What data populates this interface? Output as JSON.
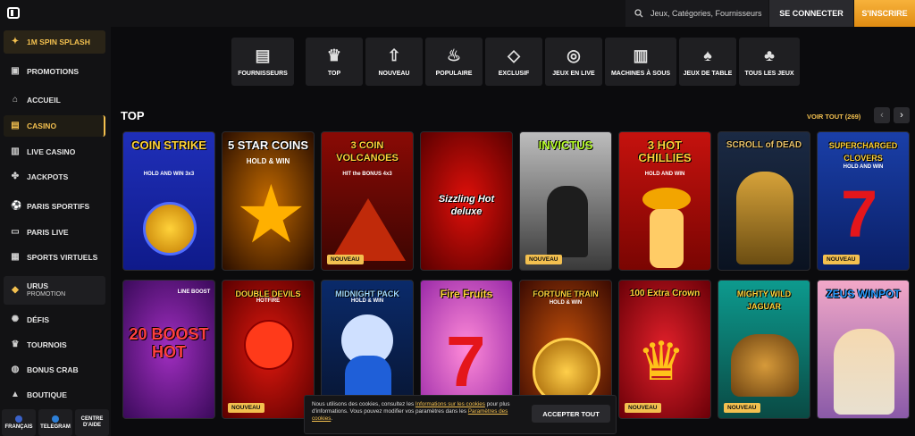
{
  "header": {
    "search_placeholder": "Jeux, Catégories, Fournisseurs",
    "login_label": "SE CONNECTER",
    "signup_label": "S'INSCRIRE"
  },
  "sidebar": {
    "promo_top": "1M SPIN SPLASH",
    "items": [
      {
        "label": "PROMOTIONS",
        "icon": "gift-icon"
      },
      {
        "label": "ACCUEIL",
        "icon": "home-icon"
      },
      {
        "label": "CASINO",
        "icon": "casino-icon"
      },
      {
        "label": "LIVE CASINO",
        "icon": "live-casino-icon"
      },
      {
        "label": "JACKPOTS",
        "icon": "jackpot-icon"
      },
      {
        "label": "PARIS SPORTIFS",
        "icon": "sports-icon"
      },
      {
        "label": "PARIS LIVE",
        "icon": "live-bet-icon"
      },
      {
        "label": "SPORTS VIRTUELS",
        "icon": "virtual-sports-icon"
      },
      {
        "label": "DÉFIS",
        "icon": "challenge-icon"
      },
      {
        "label": "TOURNOIS",
        "icon": "trophy-icon"
      },
      {
        "label": "BONUS CRAB",
        "icon": "crab-icon"
      },
      {
        "label": "BOUTIQUE",
        "icon": "shop-icon"
      }
    ],
    "urus_title": "URUS",
    "urus_sub": "PROMOTION",
    "bottom": [
      "FRANÇAIS",
      "TELEGRAM",
      "CENTRE D'AIDE"
    ]
  },
  "categories": [
    "FOURNISSEURS",
    "TOP",
    "NOUVEAU",
    "POPULAIRE",
    "EXCLUSIF",
    "JEUX EN LIVE",
    "MACHINES À SOUS",
    "JEUX DE TABLE",
    "TOUS LES JEUX"
  ],
  "section": {
    "title": "TOP",
    "see_all": "VOIR TOUT (269)"
  },
  "games_row1": [
    {
      "title": "COIN STRIKE",
      "sub": "HOLD AND WIN 3x3",
      "badge": ""
    },
    {
      "title": "5 STAR COINS",
      "sub": "HOLD & WIN",
      "badge": ""
    },
    {
      "title": "3 COIN VOLCANOES",
      "sub": "HIT the BONUS 4x3",
      "badge": "NOUVEAU"
    },
    {
      "title": "Sizzling Hot deluxe",
      "sub": "",
      "badge": ""
    },
    {
      "title": "INVICTUS",
      "sub": "",
      "badge": "NOUVEAU"
    },
    {
      "title": "3 HOT CHILLIES",
      "sub": "HOLD AND WIN",
      "badge": ""
    },
    {
      "title": "SCROLL of DEAD",
      "sub": "",
      "badge": ""
    },
    {
      "title": "SUPERCHARGED CLOVERS",
      "sub": "HOLD AND WIN",
      "badge": "NOUVEAU"
    }
  ],
  "games_row2": [
    {
      "title": "20 BOOST HOT",
      "sub": "LINE BOOST",
      "badge": ""
    },
    {
      "title": "DOUBLE DEVILS",
      "sub": "HOTFIRE",
      "badge": "NOUVEAU"
    },
    {
      "title": "MIDNIGHT PACK",
      "sub": "HOLD & WIN",
      "badge": ""
    },
    {
      "title": "Fire Fruits",
      "sub": "",
      "badge": ""
    },
    {
      "title": "FORTUNE TRAIN",
      "sub": "HOLD & WIN",
      "badge": ""
    },
    {
      "title": "100 Extra Crown",
      "sub": "",
      "badge": "NOUVEAU"
    },
    {
      "title": "MIGHTY WILD JAGUAR",
      "sub": "",
      "badge": "NOUVEAU"
    },
    {
      "title": "ZEUS WINPOT",
      "sub": "",
      "badge": ""
    }
  ],
  "cookie": {
    "text_a": "Nous utilisons des cookies, consultez les ",
    "link_a": "Informations sur les cookies",
    "text_b": " pour plus d'informations. Vous pouvez modifier vos paramètres dans les ",
    "link_b": "Paramètres des cookies",
    "text_c": ".",
    "accept_label": "ACCEPTER TOUT"
  }
}
